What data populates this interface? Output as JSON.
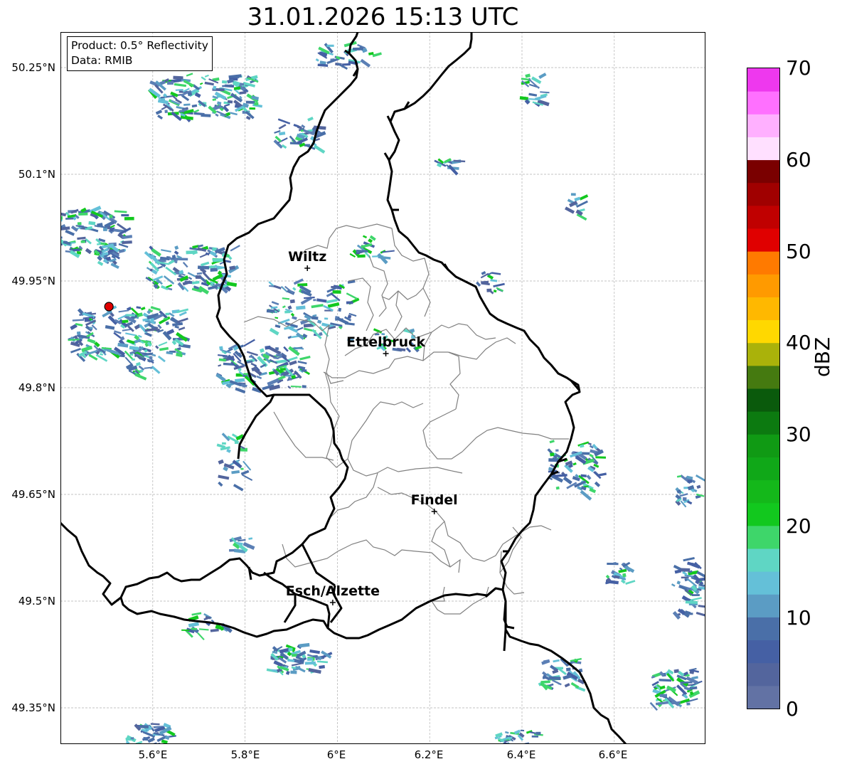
{
  "title": "31.01.2026 15:13 UTC",
  "info": {
    "product": "Product: 0.5° Reflectivity",
    "data": "Data: RMIB"
  },
  "axes": {
    "lat_labels": [
      "50.25°N",
      "50.1°N",
      "49.95°N",
      "49.8°N",
      "49.65°N",
      "49.5°N",
      "49.35°N"
    ],
    "lon_labels": [
      "5.6°E",
      "5.8°E",
      "6°E",
      "6.2°E",
      "6.4°E",
      "6.6°E"
    ],
    "grid": true
  },
  "cities": [
    {
      "name": "Wiltz",
      "lon": 5.935,
      "lat": 49.968
    },
    {
      "name": "Ettelbruck",
      "lon": 6.105,
      "lat": 49.848
    },
    {
      "name": "Findel",
      "lon": 6.21,
      "lat": 49.626
    },
    {
      "name": "Esch/Alzette",
      "lon": 5.99,
      "lat": 49.498
    }
  ],
  "radar_site": {
    "lon": 5.505,
    "lat": 49.914,
    "color": "#e00000"
  },
  "colorbar": {
    "label": "dBZ",
    "ticks": [
      "70",
      "60",
      "50",
      "40",
      "30",
      "20",
      "10",
      "0"
    ],
    "min": 0,
    "max": 70,
    "step": 2.5,
    "colors": [
      "#6272a4",
      "#53659d",
      "#4560a4",
      "#4a6fa8",
      "#5b9cc4",
      "#64c0d8",
      "#5fd6c4",
      "#3ed66a",
      "#12c81e",
      "#14b81a",
      "#10a818",
      "#109a14",
      "#0c7a10",
      "#0a5a0c",
      "#457a10",
      "#aab20a",
      "#ffd800",
      "#ffb800",
      "#ff9a00",
      "#ff7a00",
      "#e00000",
      "#c00000",
      "#a00000",
      "#7a0000",
      "#ffe0ff",
      "#ffb0ff",
      "#ff70ff",
      "#ee38ee"
    ]
  }
}
